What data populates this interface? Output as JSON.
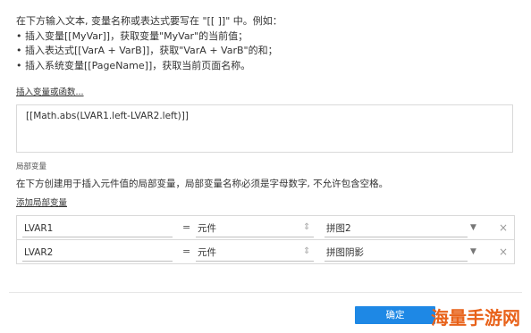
{
  "intro": {
    "line1": "在下方输入文本, 变量名称或表达式要写在 \"[[ ]]\" 中。例如：",
    "line2": "• 插入变量[[MyVar]]，获取变量\"MyVar\"的当前值；",
    "line3": "• 插入表达式[[VarA + VarB]]，获取\"VarA + VarB\"的和；",
    "line4": "• 插入系统变量[[PageName]]，获取当前页面名称。"
  },
  "insert_var_link": "插入变量或函数...",
  "expression": "[[Math.abs(LVAR1.left-LVAR2.left)]]",
  "local_vars": {
    "section_label": "局部变量",
    "description": "在下方创建用于插入元件值的局部变量，局部变量名称必须是字母数字, 不允许包含空格。",
    "add_link": "添加局部变量",
    "rows": [
      {
        "name": "LVAR1",
        "eq": "=",
        "type": "元件",
        "target": "拼图2"
      },
      {
        "name": "LVAR2",
        "eq": "=",
        "type": "元件",
        "target": "拼图阴影"
      }
    ]
  },
  "ok_button": "确定",
  "watermark": "海量手游网",
  "icons": {
    "updown": "updown-arrows-icon",
    "caret": "caret-down-icon",
    "close": "close-icon"
  }
}
